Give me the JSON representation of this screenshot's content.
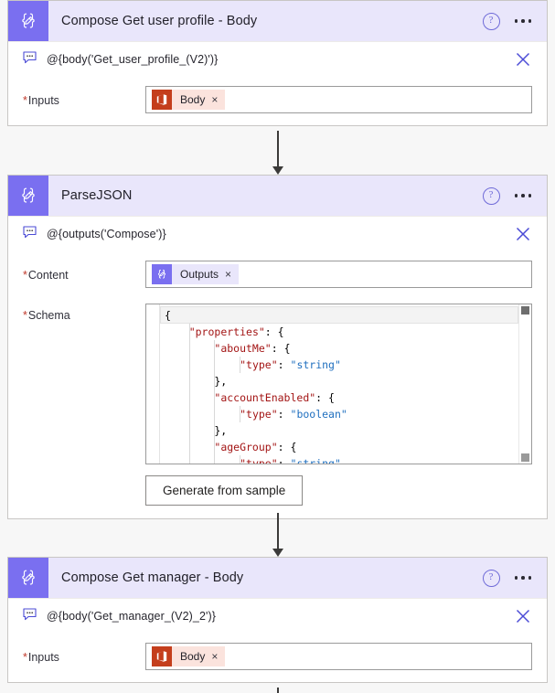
{
  "canvas": {
    "background": "#f7f7f7",
    "accent_purple": "#7a6ff0",
    "header_purple": "#e9e6fb",
    "office_orange": "#c43e1c",
    "required_red": "#c0392b",
    "link_blue": "#4b4bd6"
  },
  "cards": [
    {
      "id": "compose-get-user-profile-body",
      "icon_name": "compose-braces-pencil-icon",
      "title": "Compose Get user profile - Body",
      "help_label": "?",
      "menu_label": "•••",
      "expression": "@{body('Get_user_profile_(V2)')}",
      "comment_icon_name": "comment-bubble-icon",
      "close_icon_name": "close-icon",
      "fields": [
        {
          "required": "*",
          "label": "Inputs",
          "token": {
            "kind": "office",
            "icon_name": "office-365-icon",
            "label": "Body",
            "remove": "×"
          }
        }
      ]
    },
    {
      "id": "parsejson",
      "icon_name": "compose-braces-pencil-icon",
      "title": "ParseJSON",
      "help_label": "?",
      "menu_label": "•••",
      "expression": "@{outputs('Compose')}",
      "comment_icon_name": "comment-bubble-icon",
      "close_icon_name": "close-icon",
      "fields": [
        {
          "required": "*",
          "label": "Content",
          "token": {
            "kind": "flow",
            "icon_name": "compose-braces-pencil-icon",
            "label": "Outputs",
            "remove": "×"
          }
        },
        {
          "required": "*",
          "label": "Schema",
          "editor": true
        }
      ],
      "generate_button": "Generate from sample"
    },
    {
      "id": "compose-get-manager-body",
      "icon_name": "compose-braces-pencil-icon",
      "title": "Compose Get manager - Body",
      "help_label": "?",
      "menu_label": "•••",
      "expression": "@{body('Get_manager_(V2)_2')}",
      "comment_icon_name": "comment-bubble-icon",
      "close_icon_name": "close-icon",
      "fields": [
        {
          "required": "*",
          "label": "Inputs",
          "token": {
            "kind": "office",
            "icon_name": "office-365-icon",
            "label": "Body",
            "remove": "×"
          }
        }
      ]
    }
  ],
  "schema_editor": {
    "lines": [
      "{",
      "    \"properties\": {",
      "        \"aboutMe\": {",
      "            \"type\": \"string\"",
      "        },",
      "        \"accountEnabled\": {",
      "            \"type\": \"boolean\"",
      "        },",
      "        \"ageGroup\": {",
      "            \"type\": \"string\""
    ],
    "active_line_index": 0,
    "scroll_position": "top"
  }
}
